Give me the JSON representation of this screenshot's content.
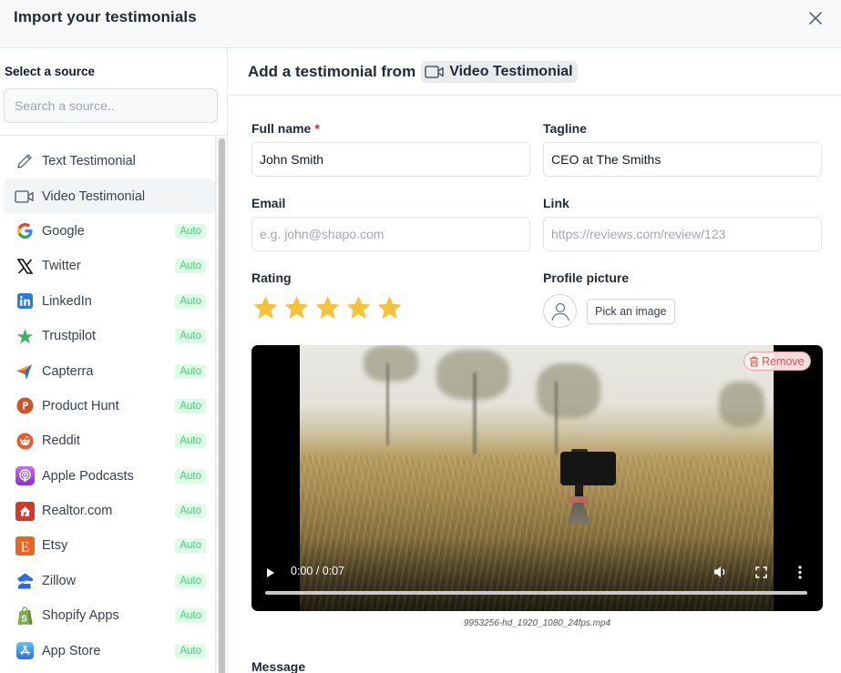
{
  "header": {
    "title": "Import your testimonials",
    "close_icon": "close-icon"
  },
  "sidebar": {
    "heading": "Select a source",
    "search_placeholder": "Search a source..",
    "items": [
      {
        "label": "Text Testimonial",
        "icon": "pencil-icon",
        "badge": null,
        "active": false
      },
      {
        "label": "Video Testimonial",
        "icon": "video-camera-icon",
        "badge": null,
        "active": true
      },
      {
        "label": "Google",
        "icon": "google-icon",
        "badge": "Auto",
        "active": false
      },
      {
        "label": "Twitter",
        "icon": "x-twitter-icon",
        "badge": "Auto",
        "active": false
      },
      {
        "label": "LinkedIn",
        "icon": "linkedin-icon",
        "badge": "Auto",
        "active": false
      },
      {
        "label": "Trustpilot",
        "icon": "trustpilot-star-icon",
        "badge": "Auto",
        "active": false
      },
      {
        "label": "Capterra",
        "icon": "capterra-icon",
        "badge": "Auto",
        "active": false
      },
      {
        "label": "Product Hunt",
        "icon": "product-hunt-icon",
        "badge": "Auto",
        "active": false
      },
      {
        "label": "Reddit",
        "icon": "reddit-icon",
        "badge": "Auto",
        "active": false
      },
      {
        "label": "Apple Podcasts",
        "icon": "apple-podcasts-icon",
        "badge": "Auto",
        "active": false
      },
      {
        "label": "Realtor.com",
        "icon": "realtor-icon",
        "badge": "Auto",
        "active": false
      },
      {
        "label": "Etsy",
        "icon": "etsy-icon",
        "badge": "Auto",
        "active": false
      },
      {
        "label": "Zillow",
        "icon": "zillow-icon",
        "badge": "Auto",
        "active": false
      },
      {
        "label": "Shopify Apps",
        "icon": "shopify-icon",
        "badge": "Auto",
        "active": false
      },
      {
        "label": "App Store",
        "icon": "app-store-icon",
        "badge": "Auto",
        "active": false
      }
    ]
  },
  "main": {
    "heading_prefix": "Add a testimonial from",
    "source_chip": "Video Testimonial",
    "fields": {
      "full_name": {
        "label": "Full name",
        "required_mark": "*",
        "value": "John Smith",
        "placeholder": ""
      },
      "tagline": {
        "label": "Tagline",
        "value": "CEO at The Smiths",
        "placeholder": ""
      },
      "email": {
        "label": "Email",
        "value": "",
        "placeholder": "e.g. john@shapo.com"
      },
      "link": {
        "label": "Link",
        "value": "",
        "placeholder": "https://reviews.com/review/123"
      }
    },
    "rating": {
      "label": "Rating",
      "value": 5,
      "max": 5
    },
    "profile_picture": {
      "label": "Profile picture",
      "button": "Pick an image"
    },
    "video": {
      "time": "0:00 / 0:07",
      "progress": 0,
      "remove_label": "Remove",
      "filename": "9953256-hd_1920_1080_24fps.mp4"
    },
    "message_label": "Message"
  },
  "colors": {
    "star": "#f5c33b",
    "badge_bg": "#dcfce7",
    "badge_text": "#52c47a",
    "required": "#dc2626",
    "remove": "#e05555"
  }
}
